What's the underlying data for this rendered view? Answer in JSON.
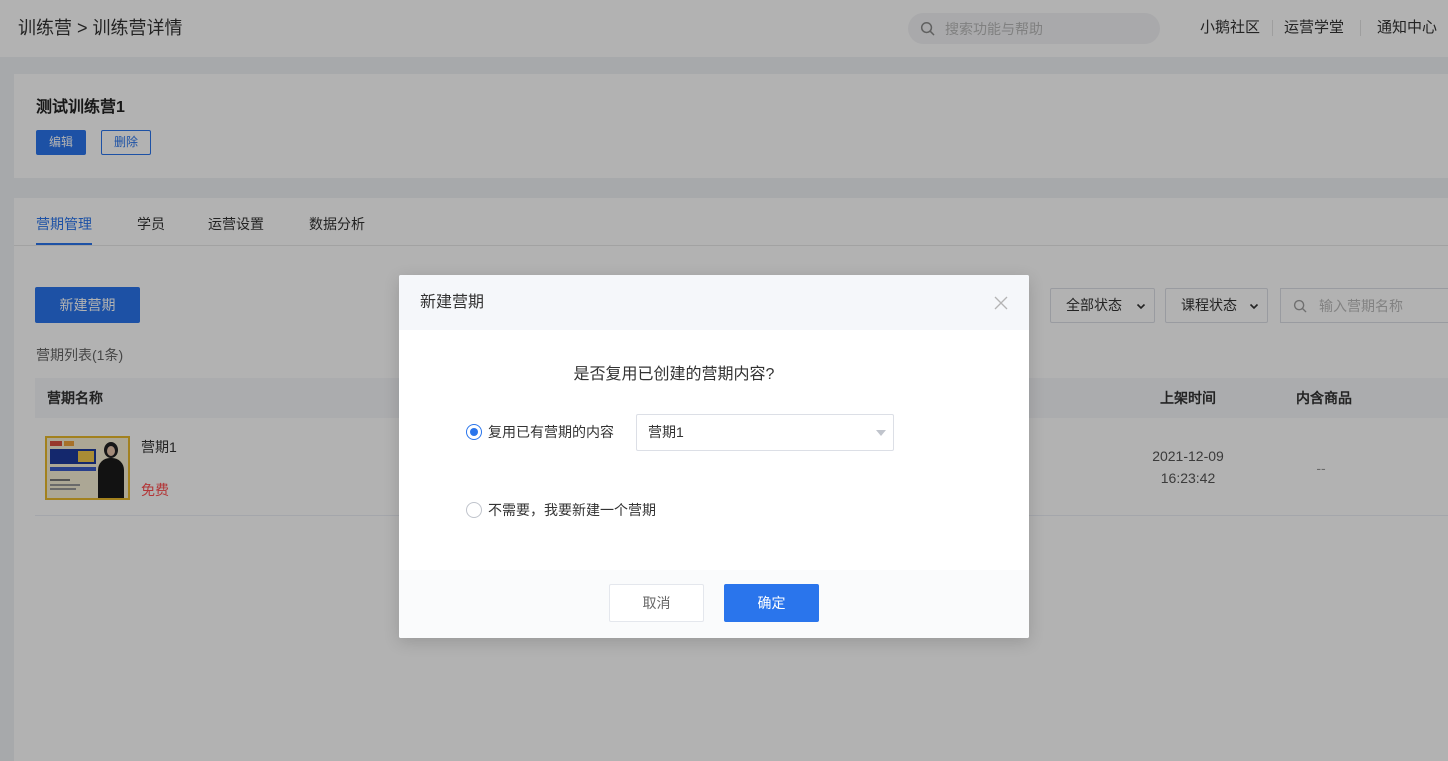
{
  "header": {
    "breadcrumb": "训练营 > 训练营详情",
    "search_placeholder": "搜索功能与帮助",
    "links": [
      "小鹅社区",
      "运营学堂",
      "通知中心"
    ]
  },
  "camp": {
    "title": "测试训练营1",
    "edit_label": "编辑",
    "delete_label": "删除"
  },
  "tabs": [
    {
      "label": "营期管理",
      "active": true
    },
    {
      "label": "学员",
      "active": false
    },
    {
      "label": "运营设置",
      "active": false
    },
    {
      "label": "数据分析",
      "active": false
    }
  ],
  "toolbar": {
    "new_period_label": "新建营期",
    "filters": [
      {
        "value": "全部状态"
      },
      {
        "value": "课程状态"
      }
    ],
    "search_placeholder": "输入营期名称"
  },
  "list": {
    "count_label": "营期列表(1条)",
    "columns": [
      "营期名称",
      "上架时间",
      "内含商品"
    ],
    "rows": [
      {
        "name": "营期1",
        "price": "免费",
        "date": "2021-12-09",
        "time": "16:23:42",
        "products": "--"
      }
    ]
  },
  "modal": {
    "title": "新建营期",
    "question": "是否复用已创建的营期内容?",
    "options": [
      {
        "label": "复用已有营期的内容",
        "checked": true
      },
      {
        "label": "不需要，我要新建一个营期",
        "checked": false
      }
    ],
    "select_value": "营期1",
    "cancel_label": "取消",
    "confirm_label": "确定"
  },
  "colors": {
    "primary": "#2a75ec",
    "danger": "#ff4d4f",
    "overlay": "rgba(0,0,0,0.3)"
  },
  "icons": {
    "header_search": "search-icon",
    "filter_chevron": "chevron-down-icon",
    "filter_search": "search-icon",
    "modal_close": "close-icon",
    "select_caret": "caret-down-icon"
  }
}
